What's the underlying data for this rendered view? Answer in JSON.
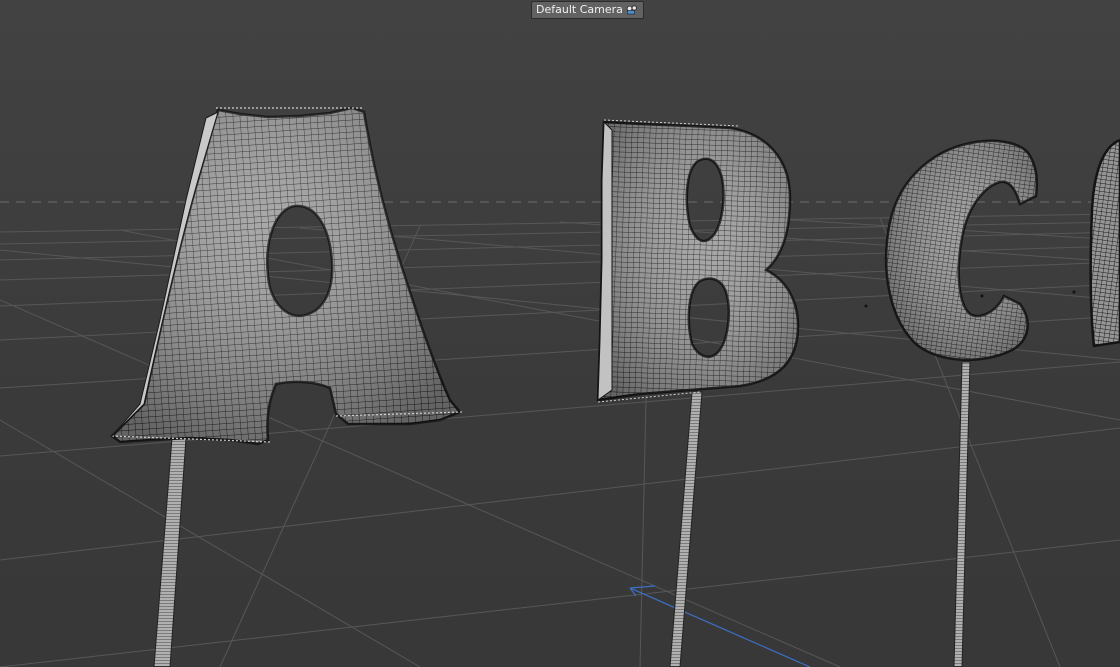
{
  "viewport": {
    "camera_label": "Default Camera",
    "camera_icon": "camera-icon",
    "background_color": "#3f3f3f",
    "grid_color": "#5a5a5a",
    "horizon_color": "#666666",
    "axis_color": "#3d6fc4",
    "objects": [
      {
        "name": "balloon-letter-a",
        "icon": "balloon-a"
      },
      {
        "name": "balloon-letter-b",
        "icon": "balloon-b"
      },
      {
        "name": "balloon-letter-c",
        "icon": "balloon-c"
      }
    ]
  }
}
